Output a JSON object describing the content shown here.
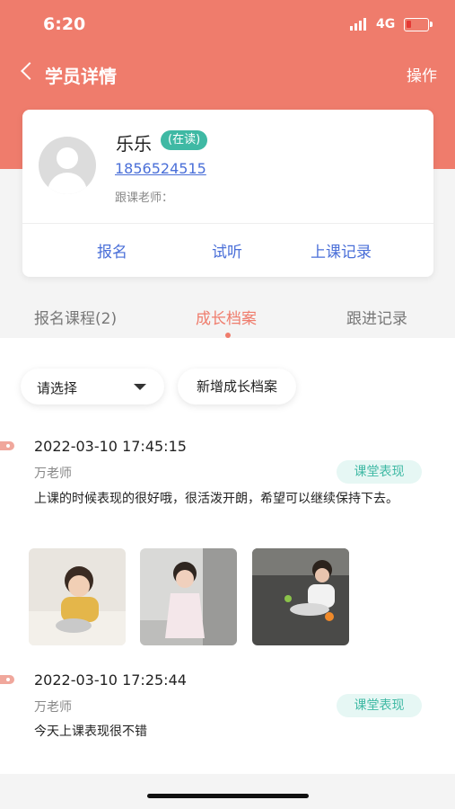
{
  "status_bar": {
    "time": "6:20",
    "network": "4G"
  },
  "nav": {
    "title": "学员详情",
    "action": "操作"
  },
  "student": {
    "name": "乐乐",
    "status": "(在读)",
    "phone": "1856524515",
    "teacher_label": "跟课老师："
  },
  "card_actions": [
    {
      "label": "报名"
    },
    {
      "label": "试听"
    },
    {
      "label": "上课记录"
    }
  ],
  "tabs": [
    {
      "label": "报名课程(2)"
    },
    {
      "label": "成长档案"
    },
    {
      "label": "跟进记录"
    }
  ],
  "active_tab": "成长档案",
  "filter": {
    "select_label": "请选择",
    "add_button": "新增成长档案"
  },
  "records": [
    {
      "time": "2022-03-10 17:45:15",
      "teacher": "万老师",
      "tag": "课堂表现",
      "text": "上课的时候表现的很好哦，很活泼开朗，希望可以继续保持下去。",
      "photos": 3
    },
    {
      "time": "2022-03-10 17:25:44",
      "teacher": "万老师",
      "tag": "课堂表现",
      "text": "今天上课表现很不错",
      "photos": 0
    }
  ],
  "colors": {
    "brand": "#ef7c6c",
    "link": "#4a6fd8",
    "accent": "#3fb9a4"
  }
}
